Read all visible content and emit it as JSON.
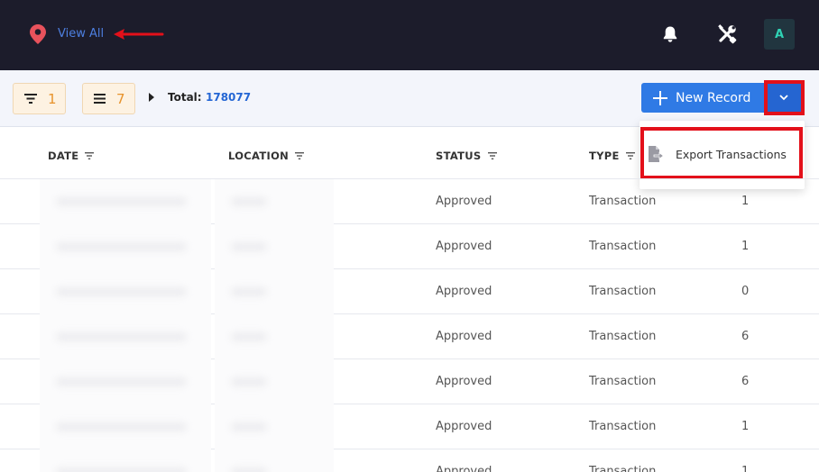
{
  "header": {
    "location_link": "View All",
    "avatar_initial": "A"
  },
  "toolbar": {
    "filter_count": "1",
    "columns_count": "7",
    "total_label": "Total:",
    "total_value": "178077",
    "new_record_label": "New Record"
  },
  "dropdown": {
    "items": [
      {
        "label": "Export Transactions",
        "icon": "file-export-icon"
      }
    ]
  },
  "table": {
    "headers": [
      "DATE",
      "LOCATION",
      "STATUS",
      "TYPE"
    ],
    "rows": [
      {
        "status": "Approved",
        "type": "Transaction",
        "count": "1"
      },
      {
        "status": "Approved",
        "type": "Transaction",
        "count": "1"
      },
      {
        "status": "Approved",
        "type": "Transaction",
        "count": "0"
      },
      {
        "status": "Approved",
        "type": "Transaction",
        "count": "6"
      },
      {
        "status": "Approved",
        "type": "Transaction",
        "count": "6"
      },
      {
        "status": "Approved",
        "type": "Transaction",
        "count": "1"
      },
      {
        "status": "Approved",
        "type": "Transaction",
        "count": "1"
      }
    ]
  },
  "colors": {
    "topbar": "#1c1c2b",
    "primary": "#2f7ae5",
    "highlight": "#e3101a",
    "chip_text": "#e7932c",
    "avatar_text": "#2fd3b5"
  }
}
